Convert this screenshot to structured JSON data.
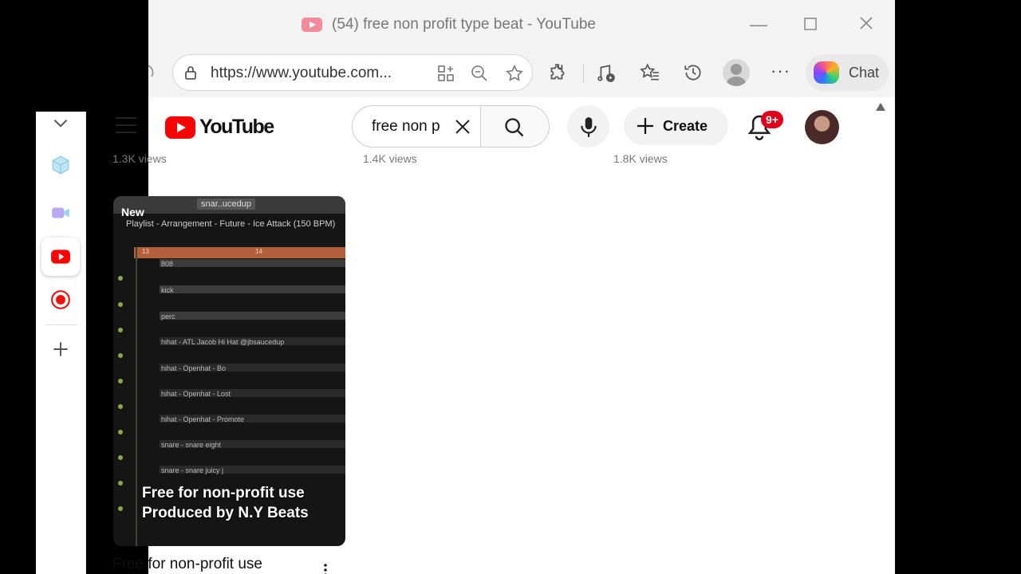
{
  "browser": {
    "tab_title": "(54) free non profit type beat - YouTube",
    "address": "https://www.youtube.com...",
    "chat_label": "Chat"
  },
  "youtube": {
    "logo_text": "YouTube",
    "search_value": "free non p",
    "create_label": "Create",
    "notification_count": "9+",
    "views": [
      "1.3K views",
      "1.4K views",
      "1.8K views"
    ],
    "video": {
      "badge": "New",
      "thumb_tag": "snar..ucedup",
      "playlist_title": "Playlist - Arrangement - Future - Ice Attack (150 BPM)",
      "ruler_marks": [
        "13",
        "14"
      ],
      "lanes": [
        "808",
        "kick",
        "perc",
        "hihat - ATL Jacob Hi Hat @jbsaucedup",
        "hihat - Openhat - Bo",
        "hihat - Openhat - Lost",
        "hihat - Openhat - Promote",
        "snare - snare eight",
        "snare - snare juicy j"
      ],
      "overlay_line1": "Free for non-profit use",
      "overlay_line2": "Produced by N.Y Beats",
      "title": "Free for non-profit use"
    }
  },
  "colors": {
    "youtube_red": "#ff0000",
    "notification_red": "#e0001b",
    "timeline_orange": "#b3603a"
  },
  "icons": [
    "refresh-icon",
    "lock-icon",
    "app-grid-icon",
    "zoom-icon",
    "favorite-star-icon",
    "extensions-icon",
    "media-icon",
    "favorites-icon",
    "history-icon",
    "copilot-icon",
    "chevron-down-icon",
    "hamburger-icon",
    "clear-icon",
    "search-icon",
    "mic-icon",
    "plus-icon",
    "bell-icon"
  ]
}
